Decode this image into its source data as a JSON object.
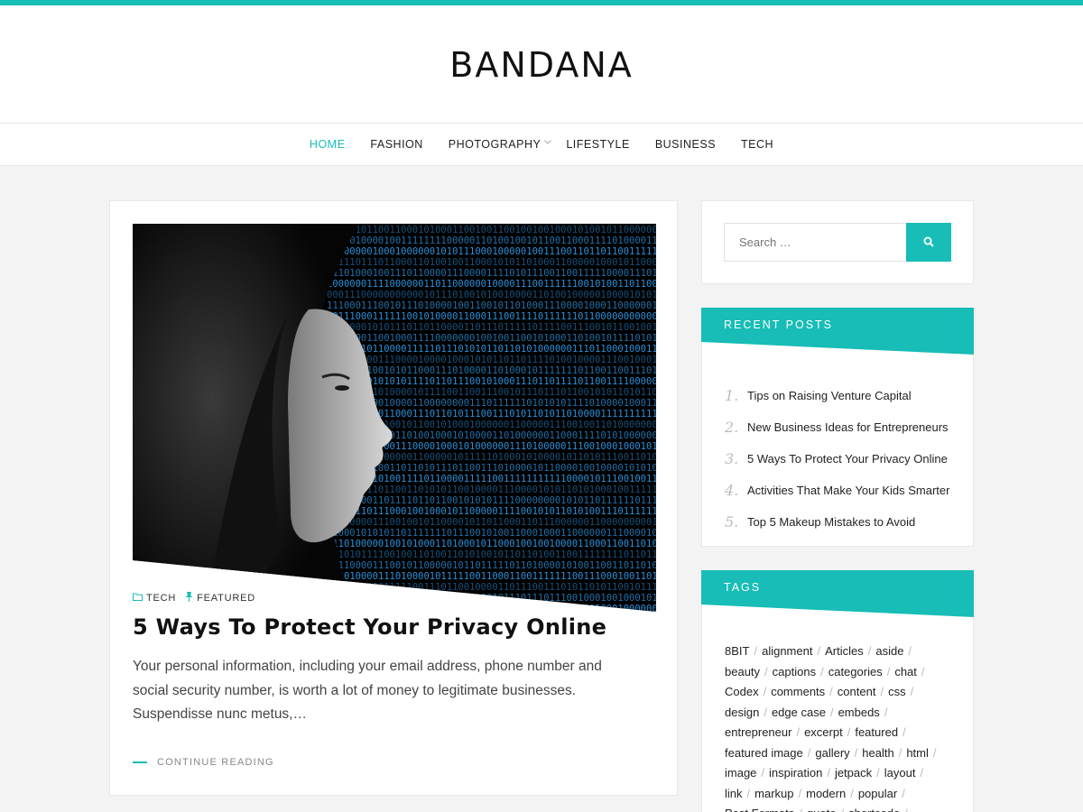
{
  "brand": {
    "logo": "BANDANA",
    "accent": "#17bdb6"
  },
  "nav": {
    "items": [
      {
        "label": "HOME",
        "active": true
      },
      {
        "label": "FASHION"
      },
      {
        "label": "PHOTOGRAPHY",
        "has_submenu": true
      },
      {
        "label": "LIFESTYLE"
      },
      {
        "label": "BUSINESS"
      },
      {
        "label": "TECH"
      }
    ]
  },
  "post": {
    "image_alt": "woman profile with binary code",
    "categories": [
      {
        "label": "TECH",
        "icon": "folder-icon"
      },
      {
        "label": "FEATURED",
        "icon": "pin-icon"
      }
    ],
    "title": "5 Ways To Protect Your Privacy Online",
    "excerpt": "Your personal information, including your email address, phone number and social security number, is worth a lot of money to legitimate businesses. Suspendisse nunc metus,…",
    "read_more": "CONTINUE READING"
  },
  "search": {
    "placeholder": "Search …",
    "icon": "search-icon"
  },
  "recent_posts": {
    "title": "RECENT POSTS",
    "items": [
      {
        "num": "1.",
        "title": "Tips on Raising Venture Capital"
      },
      {
        "num": "2.",
        "title": "New Business Ideas for Entrepreneurs"
      },
      {
        "num": "3.",
        "title": "5 Ways To Protect Your Privacy Online"
      },
      {
        "num": "4.",
        "title": "Activities That Make Your Kids Smarter"
      },
      {
        "num": "5.",
        "title": "Top 5 Makeup Mistakes to Avoid"
      }
    ]
  },
  "tags": {
    "title": "TAGS",
    "lines": [
      [
        "8BIT",
        "alignment",
        "Articles",
        "aside"
      ],
      [
        "beauty",
        "captions",
        "categories",
        "chat"
      ],
      [
        "Codex",
        "comments",
        "content",
        "css"
      ],
      [
        "design",
        "edge case",
        "embeds"
      ],
      [
        "entrepreneur",
        "excerpt",
        "featured"
      ],
      [
        "featured image",
        "gallery",
        "health",
        "html"
      ],
      [
        "image",
        "inspiration",
        "jetpack",
        "layout"
      ],
      [
        "link",
        "markup",
        "modern",
        "popular"
      ],
      [
        "Post Formats",
        "quote",
        "shortcode"
      ]
    ]
  }
}
